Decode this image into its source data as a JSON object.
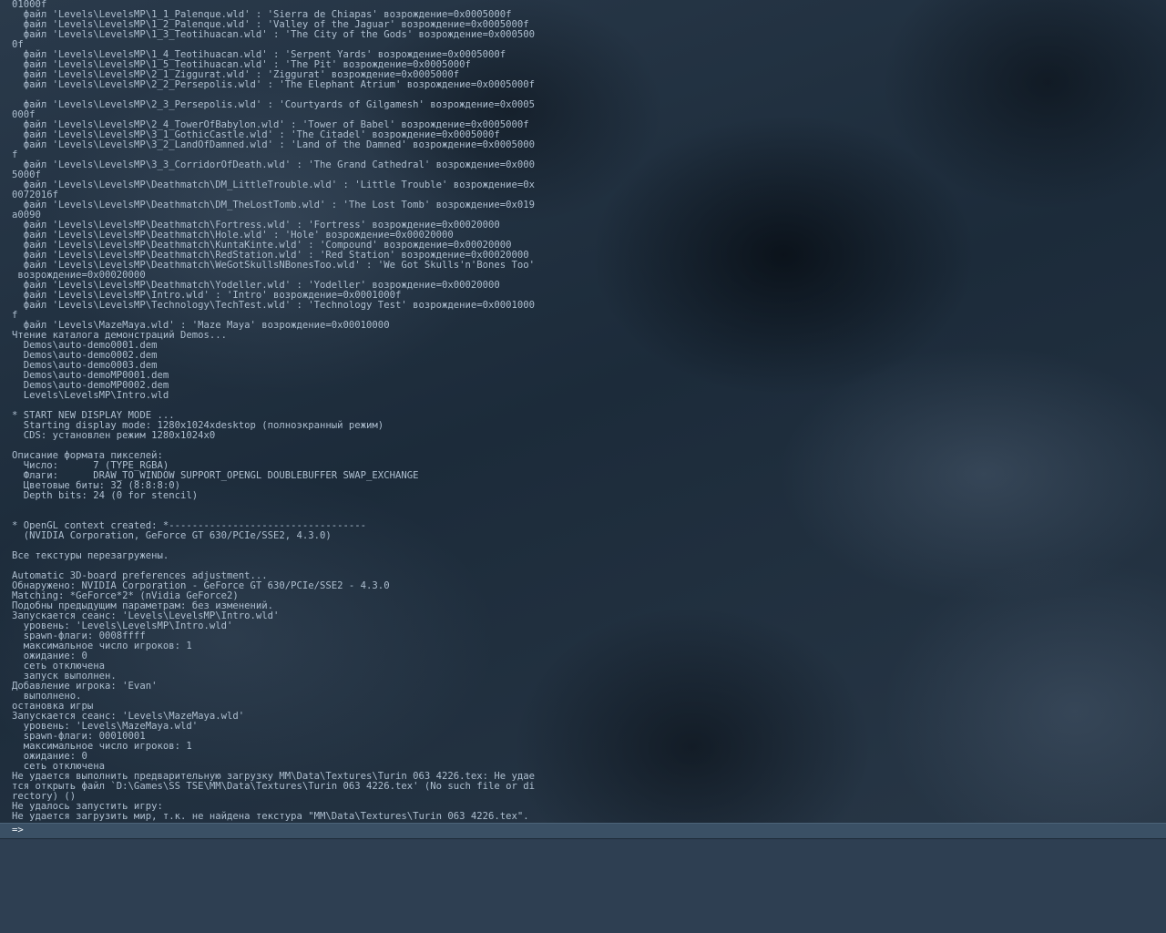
{
  "console": {
    "lines": [
      "01000f",
      "  файл 'Levels\\LevelsMP\\1_1_Palenque.wld' : 'Sierra de Chiapas' возрождение=0x0005000f",
      "  файл 'Levels\\LevelsMP\\1_2_Palenque.wld' : 'Valley of the Jaguar' возрождение=0x0005000f",
      "  файл 'Levels\\LevelsMP\\1_3_Teotihuacan.wld' : 'The City of the Gods' возрождение=0x000500",
      "0f",
      "  файл 'Levels\\LevelsMP\\1_4_Teotihuacan.wld' : 'Serpent Yards' возрождение=0x0005000f",
      "  файл 'Levels\\LevelsMP\\1_5_Teotihuacan.wld' : 'The Pit' возрождение=0x0005000f",
      "  файл 'Levels\\LevelsMP\\2_1_Ziggurat.wld' : 'Ziggurat' возрождение=0x0005000f",
      "  файл 'Levels\\LevelsMP\\2_2_Persepolis.wld' : 'The Elephant Atrium' возрождение=0x0005000f",
      "",
      "  файл 'Levels\\LevelsMP\\2_3_Persepolis.wld' : 'Courtyards of Gilgamesh' возрождение=0x0005",
      "000f",
      "  файл 'Levels\\LevelsMP\\2_4_TowerOfBabylon.wld' : 'Tower of Babel' возрождение=0x0005000f",
      "  файл 'Levels\\LevelsMP\\3_1_GothicCastle.wld' : 'The Citadel' возрождение=0x0005000f",
      "  файл 'Levels\\LevelsMP\\3_2_LandOfDamned.wld' : 'Land of the Damned' возрождение=0x0005000",
      "f",
      "  файл 'Levels\\LevelsMP\\3_3_CorridorOfDeath.wld' : 'The Grand Cathedral' возрождение=0x000",
      "5000f",
      "  файл 'Levels\\LevelsMP\\Deathmatch\\DM_LittleTrouble.wld' : 'Little Trouble' возрождение=0x",
      "0072016f",
      "  файл 'Levels\\LevelsMP\\Deathmatch\\DM_TheLostTomb.wld' : 'The Lost Tomb' возрождение=0x019",
      "a0090",
      "  файл 'Levels\\LevelsMP\\Deathmatch\\Fortress.wld' : 'Fortress' возрождение=0x00020000",
      "  файл 'Levels\\LevelsMP\\Deathmatch\\Hole.wld' : 'Hole' возрождение=0x00020000",
      "  файл 'Levels\\LevelsMP\\Deathmatch\\KuntaKinte.wld' : 'Compound' возрождение=0x00020000",
      "  файл 'Levels\\LevelsMP\\Deathmatch\\RedStation.wld' : 'Red Station' возрождение=0x00020000",
      "  файл 'Levels\\LevelsMP\\Deathmatch\\WeGotSkullsNBonesToo.wld' : 'We Got Skulls'n'Bones Too'",
      " возрождение=0x00020000",
      "  файл 'Levels\\LevelsMP\\Deathmatch\\Yodeller.wld' : 'Yodeller' возрождение=0x00020000",
      "  файл 'Levels\\LevelsMP\\Intro.wld' : 'Intro' возрождение=0x0001000f",
      "  файл 'Levels\\LevelsMP\\Technology\\TechTest.wld' : 'Technology Test' возрождение=0x0001000",
      "f",
      "  файл 'Levels\\MazeMaya.wld' : 'Maze Maya' возрождение=0x00010000",
      "Чтение каталога демонстраций Demos...",
      "  Demos\\auto-demo0001.dem",
      "  Demos\\auto-demo0002.dem",
      "  Demos\\auto-demo0003.dem",
      "  Demos\\auto-demoMP0001.dem",
      "  Demos\\auto-demoMP0002.dem",
      "  Levels\\LevelsMP\\Intro.wld",
      "",
      "* START NEW DISPLAY MODE ...",
      "  Starting display mode: 1280x1024xdesktop (полноэкранный режим)",
      "  CDS: установлен режим 1280x1024x0",
      "",
      "Описание формата пикселей:",
      "  Число:      7 (TYPE_RGBA)",
      "  Флаги:      DRAW_TO_WINDOW SUPPORT_OPENGL DOUBLEBUFFER SWAP_EXCHANGE",
      "  Цветовые биты: 32 (8:8:8:0)",
      "  Depth bits: 24 (0 for stencil)",
      "",
      "",
      "* OpenGL context created: *----------------------------------",
      "  (NVIDIA Corporation, GeForce GT 630/PCIe/SSE2, 4.3.0)",
      "",
      "Все текстуры перезагружены.",
      "",
      "Automatic 3D-board preferences adjustment...",
      "Обнаружено: NVIDIA Corporation - GeForce GT 630/PCIe/SSE2 - 4.3.0",
      "Matching: *GeForce*2* (nVidia GeForce2)",
      "Подобны предыдущим параметрам: без изменений.",
      "Запускается сеанс: 'Levels\\LevelsMP\\Intro.wld'",
      "  уровень: 'Levels\\LevelsMP\\Intro.wld'",
      "  spawn-флаги: 0008ffff",
      "  максимальное число игроков: 1",
      "  ожидание: 0",
      "  сеть отключена",
      "  запуск выполнен.",
      "Добавление игрока: 'Evan'",
      "  выполнено.",
      "остановка игры",
      "Запускается сеанс: 'Levels\\MazeMaya.wld'",
      "  уровень: 'Levels\\MazeMaya.wld'",
      "  spawn-флаги: 00010001",
      "  максимальное число игроков: 1",
      "  ожидание: 0",
      "  сеть отключена",
      "Не удается выполнить предварительную загрузку MM\\Data\\Textures\\Turin 063 4226.tex: Не удае",
      "тся открыть файл `D:\\Games\\SS TSE\\MM\\Data\\Textures\\Turin 063 4226.tex' (No such file or di",
      "rectory) ()",
      "Не удалось запустить игру:",
      "Не удается загрузить мир, т.к. не найдена текстура \"MM\\Data\\Textures\\Turin 063 4226.tex\"."
    ]
  },
  "input": {
    "prompt": "=>",
    "value": ""
  }
}
